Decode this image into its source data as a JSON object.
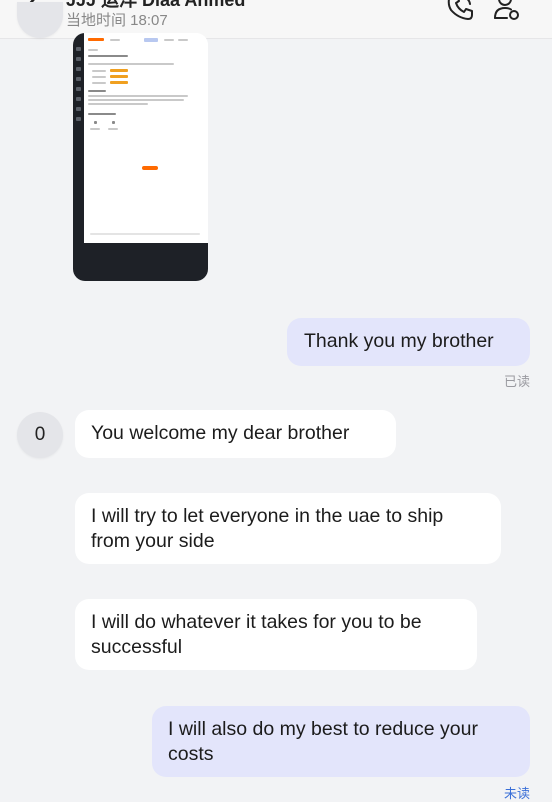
{
  "header": {
    "title": "JJJ 运洋 Diaa Ahmed",
    "subtitle": "当地时间 18:07"
  },
  "messages": [
    {
      "text": "Thank you my brother",
      "receipt": "已读"
    },
    {
      "text": "You welcome my dear brother",
      "avatar": "0"
    },
    {
      "text_line1": "I will try to let everyone in the uae to ship",
      "text_line2": "from your side"
    },
    {
      "text_line1": "I will do whatever it takes for you to be",
      "text_line2": "successful"
    },
    {
      "text_line1": "I will also do my best to reduce your",
      "text_line2": "costs",
      "receipt": "未读"
    }
  ],
  "colors": {
    "background": "#f2f3f5",
    "incoming_bubble": "#ffffff",
    "outgoing_bubble": "#e3e5fb",
    "read_receipt": "#9a9aa0",
    "unread_receipt": "#3a6fd8"
  },
  "icons": [
    "back-arrow-icon",
    "phone-call-icon",
    "user-settings-icon"
  ]
}
